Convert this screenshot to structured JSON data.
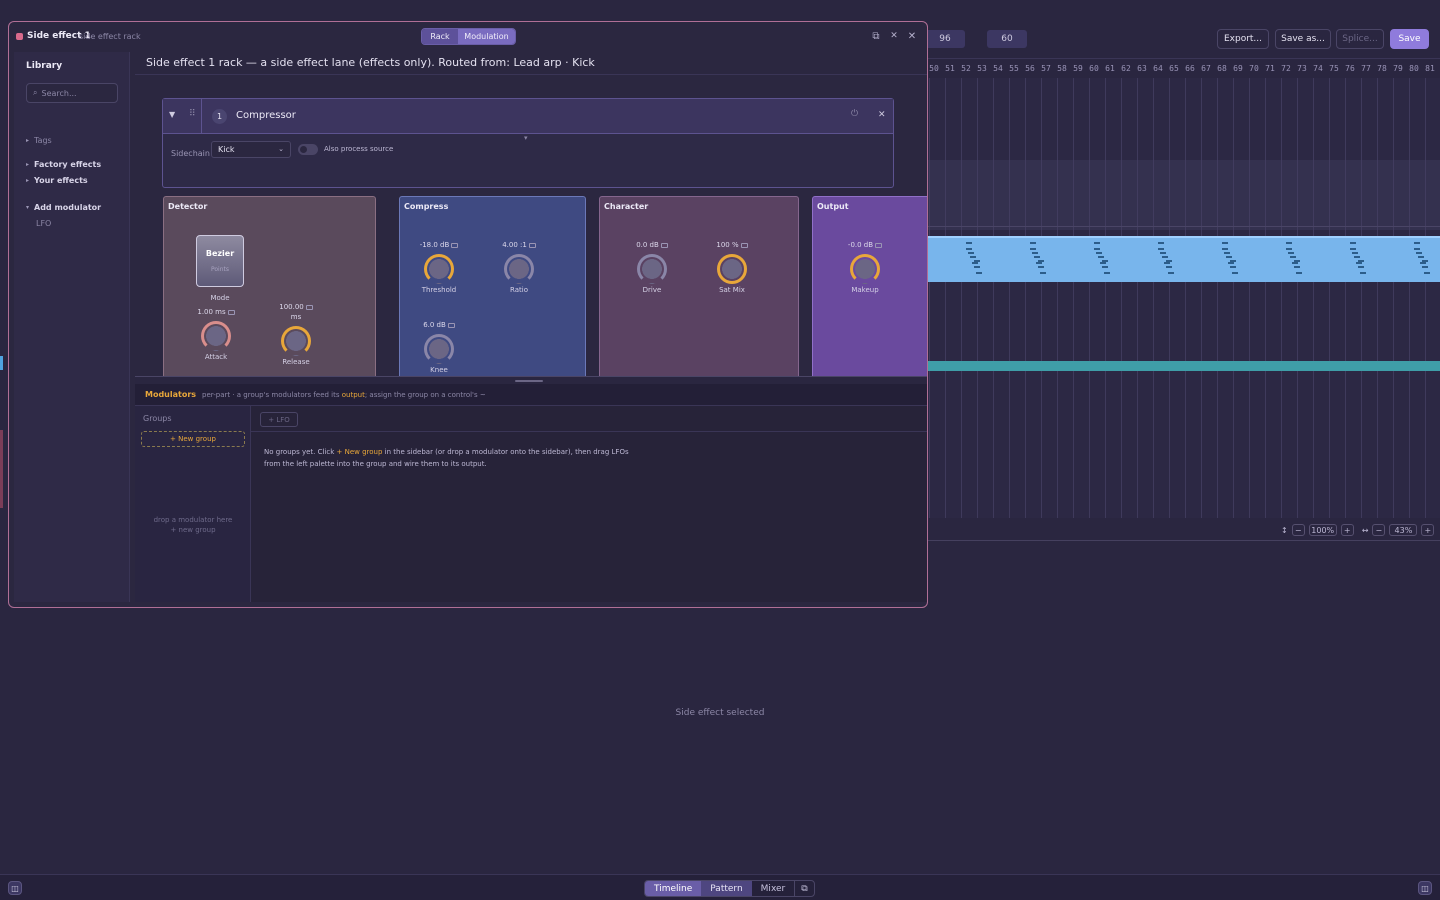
{
  "background": {
    "tempo_values": [
      "96",
      "60"
    ],
    "buttons": {
      "export": "Export...",
      "save_as": "Save as...",
      "splice": "Splice...",
      "save": "Save"
    },
    "ruler_numbers": [
      "50",
      "51",
      "52",
      "53",
      "54",
      "55",
      "56",
      "57",
      "58",
      "59",
      "60",
      "61",
      "62",
      "63",
      "64",
      "65",
      "66",
      "67",
      "68",
      "69",
      "70",
      "71",
      "72",
      "73",
      "74",
      "75",
      "76",
      "77",
      "78",
      "79",
      "80",
      "81"
    ],
    "zoom": {
      "vertical_icon": "↕",
      "vertical_minus": "−",
      "vertical_value": "100%",
      "vertical_plus": "+",
      "horizontal_icon": "↔",
      "horizontal_minus": "−",
      "horizontal_value": "43%",
      "horizontal_plus": "+"
    },
    "status_text": "Side effect selected",
    "bottom_tabs": {
      "timeline": "Timeline",
      "pattern": "Pattern",
      "mixer": "Mixer",
      "popout_icon": "⧉"
    },
    "corner_icon": "◫"
  },
  "modal": {
    "title": "Side effect 1",
    "subtitle": "side effect rack",
    "tabs": {
      "rack": "Rack",
      "modulation": "Modulation"
    },
    "icons": {
      "popout": "⧉",
      "unpin": "✕",
      "close": "✕"
    },
    "sidebar": {
      "title": "Library",
      "search_icon": "⌕",
      "search_placeholder": "Search...",
      "items": {
        "tags": "Tags",
        "factory": "Factory effects",
        "yours": "Your effects",
        "add_mod": "Add modulator",
        "lfo": "LFO"
      },
      "caret_right": "▸",
      "caret_down": "▾"
    },
    "header": "Side effect 1 rack — a side effect lane (effects only). Routed from: Lead arp · Kick",
    "device": {
      "collapse_icon": "▼",
      "drag_icon": "⠿",
      "index": "1",
      "name": "Compressor",
      "power_icon": "⏻",
      "close_icon": "✕",
      "sidechain_label": "Sidechain",
      "sidechain_value": "Kick",
      "sidechain_chev": "⌄",
      "also_process": "Also process source",
      "expand_icon": "▾",
      "panels": {
        "detector": {
          "title": "Detector",
          "mode_value": "Bezier",
          "mode_sub": "Points",
          "mode_label": "Mode",
          "attack_value": "1.00 ms",
          "attack_label": "Attack",
          "release_value": "100.00",
          "release_unit": "ms",
          "release_label": "Release"
        },
        "compress": {
          "title": "Compress",
          "threshold_value": "-18.0 dB",
          "threshold_label": "Threshold",
          "ratio_value": "4.00 :1",
          "ratio_label": "Ratio",
          "knee_value": "6.0 dB",
          "knee_label": "Knee"
        },
        "character": {
          "title": "Character",
          "drive_value": "0.0 dB",
          "drive_label": "Drive",
          "satmix_value": "100 %",
          "satmix_label": "Sat Mix"
        },
        "output": {
          "title": "Output",
          "makeup_value": "-0.0 dB",
          "makeup_label": "Makeup"
        }
      }
    },
    "modulators": {
      "title": "Modulators",
      "desc_before": "per-part · a group's modulators feed its",
      "desc_highlight": "output",
      "desc_after": "; assign the group on a control's ~",
      "groups_label": "Groups",
      "new_group": "+ New group",
      "drop_hint_1": "drop a modulator here",
      "drop_hint_2": "+ new group",
      "lfo_chip": "+ LFO",
      "msg_before": "No groups yet. Click",
      "msg_highlight": "+ New group",
      "msg_after": "in the sidebar (or drop a modulator onto the sidebar), then drag LFOs from the left palette into the group and wire them to its output."
    }
  }
}
